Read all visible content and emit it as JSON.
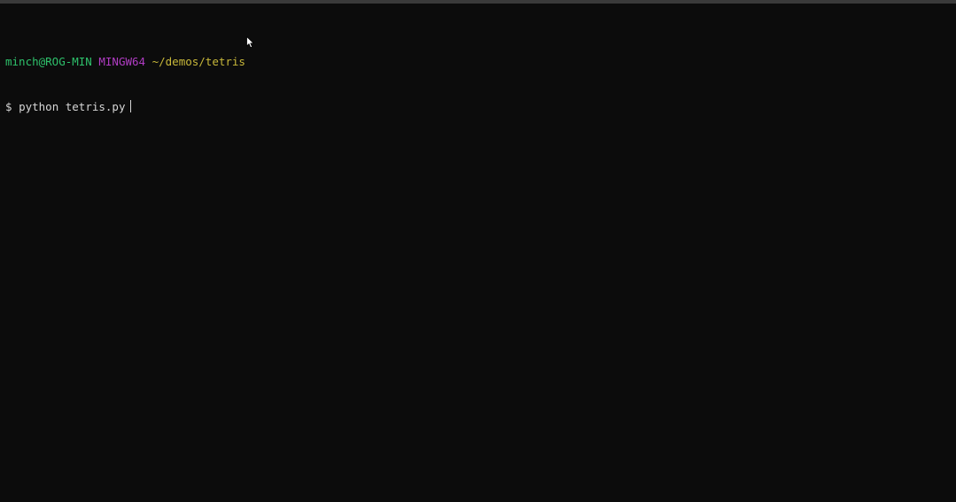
{
  "prompt": {
    "user_host": "minch@ROG-MIN",
    "system": "MINGW64",
    "cwd": "~/demos/tetris"
  },
  "command": {
    "symbol": "$",
    "text": "python tetris.py"
  },
  "colors": {
    "background": "#0c0c0c",
    "user_host": "#2ec16b",
    "system": "#b03cc3",
    "cwd": "#c8b83a",
    "text": "#d6d6d6"
  },
  "icons": {
    "pointer": "mouse-pointer-icon",
    "caret": "text-caret"
  }
}
